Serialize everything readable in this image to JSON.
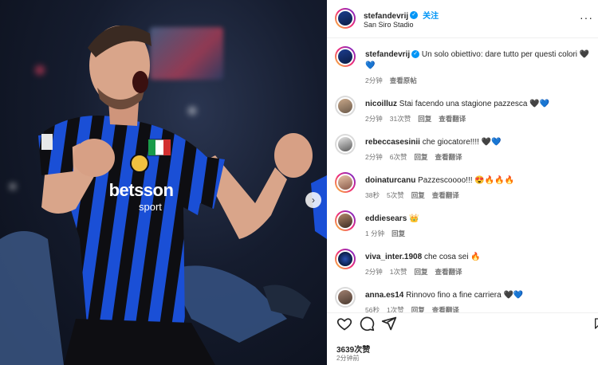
{
  "post": {
    "username": "stefandevrij",
    "follow_label": "关注",
    "location": "San Siro Stadio",
    "jersey_sponsor": "betsson",
    "jersey_sponsor_sub": "sport"
  },
  "caption": {
    "username": "stefandevrij",
    "text": "Un solo obiettivo: dare tutto per questi colori 🖤💙",
    "time": "2分钟",
    "see_original": "查看原帖"
  },
  "comments": [
    {
      "username": "nicoilluz",
      "text": "Stai facendo una stagione pazzesca 🖤💙",
      "time": "2分钟",
      "likes": "31次赞",
      "reply": "回复",
      "translate": "查看翻译"
    },
    {
      "username": "rebeccasesinii",
      "text": "che giocatore!!!! 🖤💙",
      "time": "2分钟",
      "likes": "6次赞",
      "reply": "回复",
      "translate": "查看翻译"
    },
    {
      "username": "doinaturcanu",
      "text": "Pazzescoooo!!! 😍🔥🔥🔥",
      "time": "38秒",
      "likes": "5次赞",
      "reply": "回复",
      "translate": "查看翻译"
    },
    {
      "username": "eddiesears",
      "text": "👑",
      "time": "1 分钟",
      "likes": "",
      "reply": "回复",
      "translate": ""
    },
    {
      "username": "viva_inter.1908",
      "text": "che cosa sei 🔥",
      "time": "2分钟",
      "likes": "1次赞",
      "reply": "回复",
      "translate": "查看翻译"
    },
    {
      "username": "anna.es14",
      "text": "Rinnovo fino a fine carriera 🖤💙",
      "time": "56秒",
      "likes": "1次赞",
      "reply": "回复",
      "translate": "查看翻译"
    }
  ],
  "footer": {
    "likes": "3639次赞",
    "time": "2分钟前"
  },
  "colors": {
    "inter_blue": "#1a4fd6",
    "inter_black": "#0e0e12",
    "link_blue": "#0095f6"
  }
}
